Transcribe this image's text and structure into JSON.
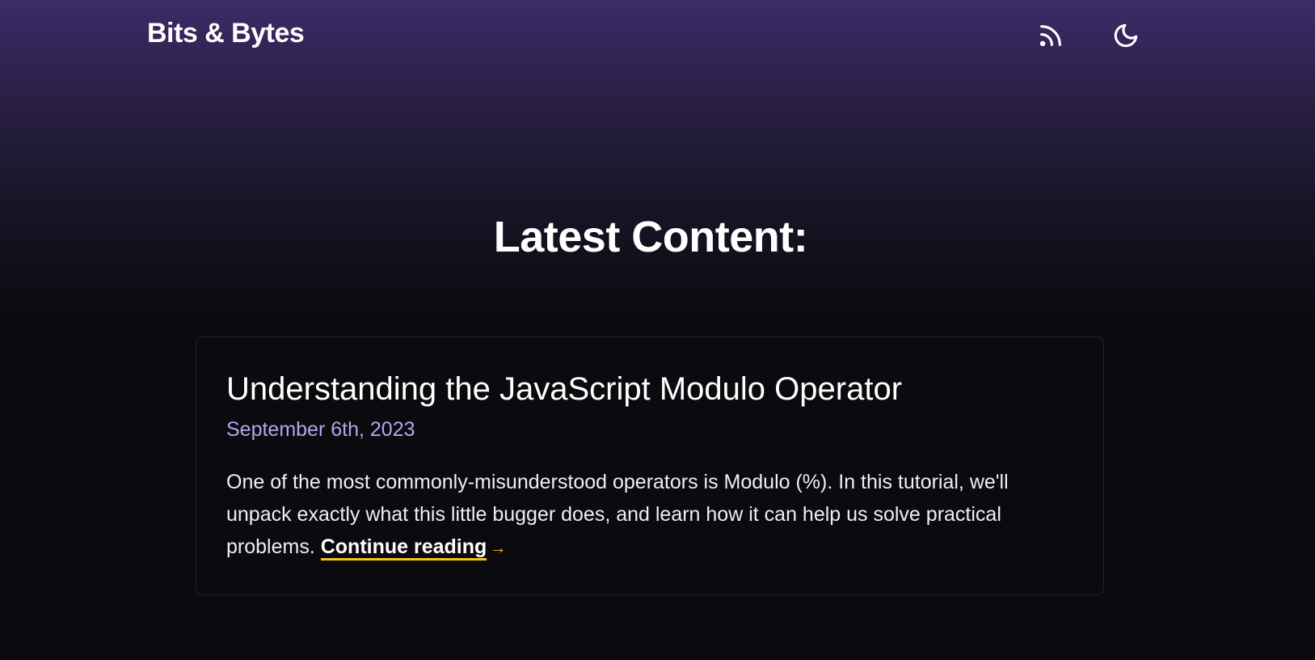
{
  "header": {
    "site_title": "Bits & Bytes",
    "rss_icon": "rss-icon",
    "theme_icon": "moon-icon"
  },
  "main": {
    "section_title": "Latest Content:",
    "posts": [
      {
        "title": "Understanding the JavaScript Modulo Operator",
        "date": "September 6th, 2023",
        "excerpt": "One of the most commonly-misunderstood operators is Modulo (%). In this tutorial, we'll unpack exactly what this little bugger does, and learn how it can help us solve practical problems.",
        "continue_label": "Continue reading",
        "continue_arrow": "→"
      }
    ]
  },
  "colors": {
    "accent_yellow": "#f5c518",
    "date_purple": "#b6a4e8",
    "header_purple": "#3c2b68",
    "background": "#0b0a0f"
  }
}
